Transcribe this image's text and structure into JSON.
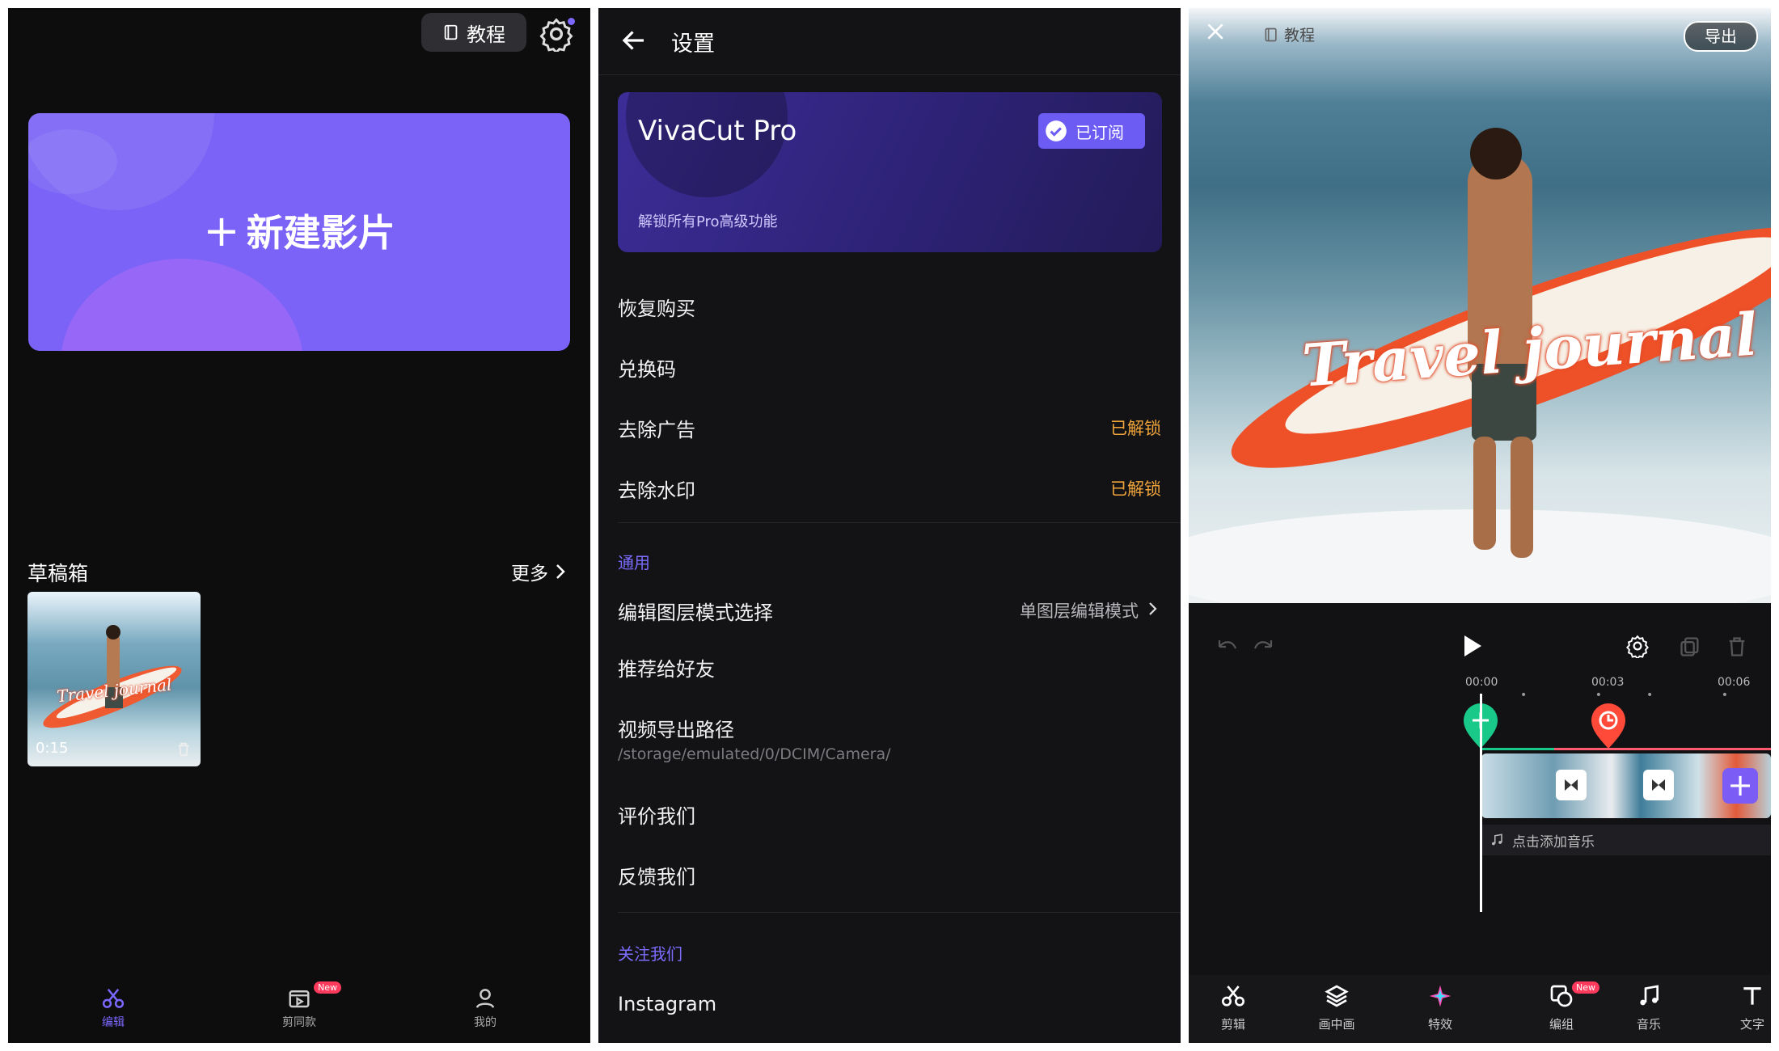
{
  "home": {
    "tutorial_label": "教程",
    "new_project_label": "新建影片",
    "drafts_title": "草稿箱",
    "more_label": "更多",
    "draft": {
      "duration": "0:15",
      "thumb_caption": "Travel journal"
    },
    "nav": [
      {
        "label": "编辑",
        "icon": "scissors-icon",
        "active": true
      },
      {
        "label": "剪同款",
        "icon": "template-icon",
        "badge": "New"
      },
      {
        "label": "我的",
        "icon": "user-icon"
      }
    ],
    "accent_color": "#7b68ff"
  },
  "settings": {
    "title": "设置",
    "pro": {
      "title": "VivaCut Pro",
      "subtitle": "解锁所有Pro高级功能",
      "subscribed_label": "已订阅"
    },
    "rows_top": [
      {
        "label": "恢复购买"
      },
      {
        "label": "兑换码"
      },
      {
        "label": "去除广告",
        "value": "已解锁"
      },
      {
        "label": "去除水印",
        "value": "已解锁"
      }
    ],
    "general_title": "通用",
    "layer_mode": {
      "label": "编辑图层模式选择",
      "value": "单图层编辑模式"
    },
    "recommend": "推荐给好友",
    "export_path": {
      "label": "视频导出路径",
      "path": "/storage/emulated/0/DCIM/Camera/"
    },
    "rate": "评价我们",
    "feedback": "反馈我们",
    "follow_title": "关注我们",
    "instagram": "Instagram",
    "unlocked_color": "#f0a43a"
  },
  "editor": {
    "tutorial_label": "教程",
    "export_label": "导出",
    "overlay_text": "Travel journal",
    "time_marks": [
      "00:00",
      "00:03",
      "00:06"
    ],
    "add_music_label": "点击添加音乐",
    "tools": [
      {
        "label": "剪辑",
        "icon": "scissors-icon"
      },
      {
        "label": "画中画",
        "icon": "layers-icon"
      },
      {
        "label": "特效",
        "icon": "sparkle-icon"
      },
      {
        "label": "编组",
        "icon": "group-icon",
        "badge": "New"
      },
      {
        "label": "音乐",
        "icon": "music-note-icon"
      },
      {
        "label": "文字",
        "icon": "text-icon"
      }
    ]
  }
}
